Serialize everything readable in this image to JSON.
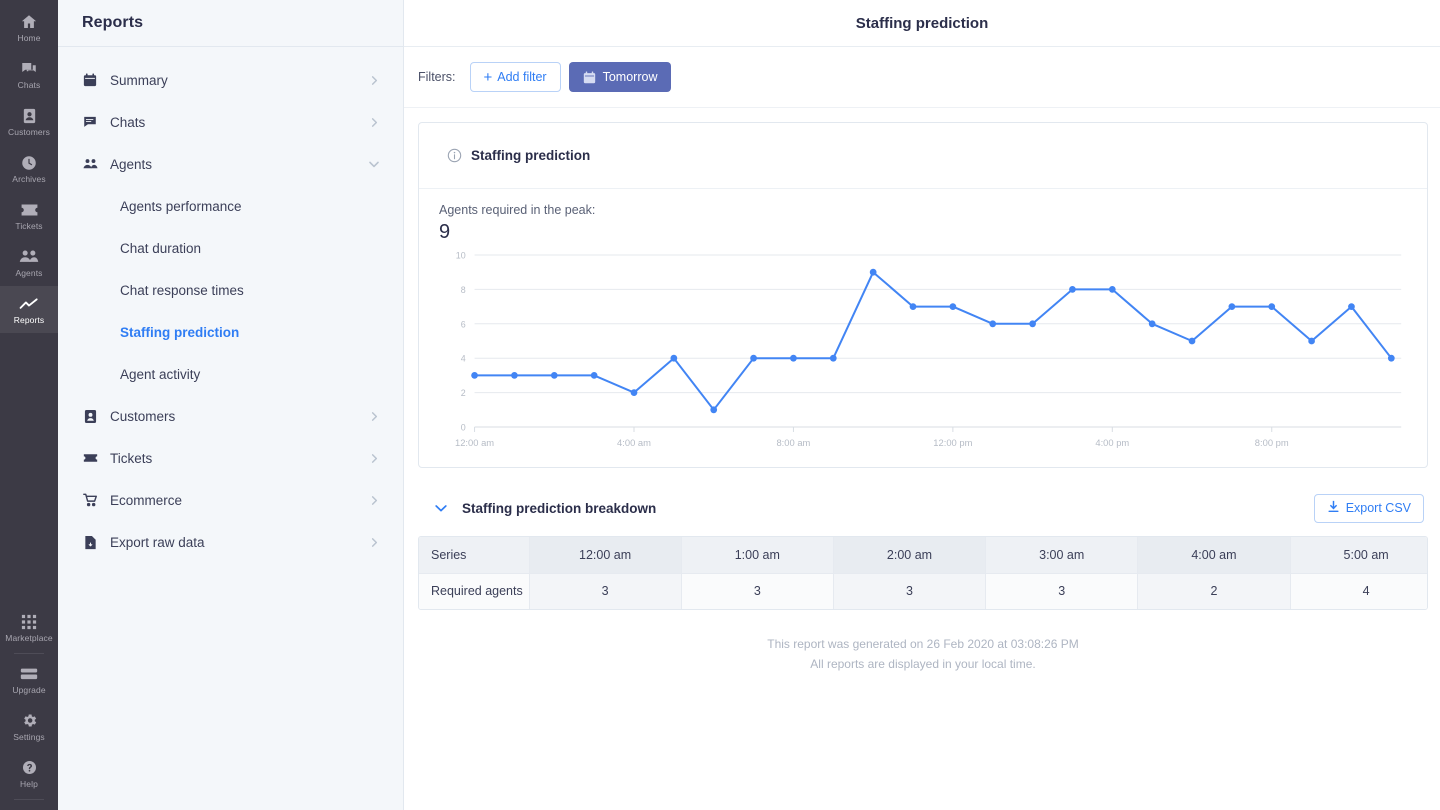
{
  "rail": {
    "top_items": [
      {
        "label": "Home",
        "icon": "home-icon",
        "active": false
      },
      {
        "label": "Chats",
        "icon": "chats-icon",
        "active": false
      },
      {
        "label": "Customers",
        "icon": "customers-icon",
        "active": false
      },
      {
        "label": "Archives",
        "icon": "archives-clock-icon",
        "active": false
      },
      {
        "label": "Tickets",
        "icon": "tickets-icon",
        "active": false
      },
      {
        "label": "Agents",
        "icon": "agents-icon",
        "active": false
      },
      {
        "label": "Reports",
        "icon": "reports-chart-icon",
        "active": true
      }
    ],
    "bottom_items": [
      {
        "label": "Marketplace",
        "icon": "marketplace-grid-icon"
      },
      {
        "label": "Upgrade",
        "icon": "upgrade-icon"
      },
      {
        "label": "Settings",
        "icon": "gear-icon"
      },
      {
        "label": "Help",
        "icon": "help-question-icon"
      }
    ]
  },
  "nav": {
    "title": "Reports",
    "items": [
      {
        "label": "Summary",
        "icon": "calendar-icon",
        "chevron": "right"
      },
      {
        "label": "Chats",
        "icon": "chat-bubble-icon",
        "chevron": "right"
      },
      {
        "label": "Agents",
        "icon": "agents-icon",
        "chevron": "down"
      }
    ],
    "sub_items": [
      {
        "label": "Agents performance",
        "selected": false
      },
      {
        "label": "Chat duration",
        "selected": false
      },
      {
        "label": "Chat response times",
        "selected": false
      },
      {
        "label": "Staffing prediction",
        "selected": true
      },
      {
        "label": "Agent activity",
        "selected": false
      }
    ],
    "items_after": [
      {
        "label": "Customers",
        "icon": "customers-card-icon",
        "chevron": "right"
      },
      {
        "label": "Tickets",
        "icon": "ticket-icon",
        "chevron": "right"
      },
      {
        "label": "Ecommerce",
        "icon": "cart-icon",
        "chevron": "right"
      },
      {
        "label": "Export raw data",
        "icon": "file-icon",
        "chevron": "right"
      }
    ]
  },
  "header": {
    "title": "Staffing prediction"
  },
  "filters": {
    "label": "Filters:",
    "add_filter_label": "Add filter",
    "date_filter_label": "Tomorrow"
  },
  "card": {
    "title": "Staffing prediction",
    "peak_label": "Agents required in the peak:",
    "peak_value": "9"
  },
  "breakdown": {
    "title": "Staffing prediction breakdown",
    "export_label": "Export CSV",
    "series_header": "Series",
    "row_label": "Required agents",
    "columns": [
      "12:00 am",
      "1:00 am",
      "2:00 am",
      "3:00 am",
      "4:00 am",
      "5:00 am"
    ],
    "values": [
      "3",
      "3",
      "3",
      "3",
      "2",
      "4"
    ]
  },
  "footnote": {
    "line1": "This report was generated on 26 Feb 2020 at 03:08:26 PM",
    "line2": "All reports are displayed in your local time."
  },
  "colors": {
    "accent_blue": "#2f7df4",
    "line_blue": "#4285f4",
    "filter_indigo": "#5b6bb5",
    "rail_bg": "#3c3a45",
    "nav_bg": "#f4f7fa"
  },
  "chart_data": {
    "type": "line",
    "title": "Staffing prediction",
    "xlabel": "",
    "ylabel": "",
    "ylim": [
      0,
      10
    ],
    "yticks": [
      0,
      2,
      4,
      6,
      8,
      10
    ],
    "xticks": [
      "12:00 am",
      "4:00 am",
      "8:00 am",
      "12:00 pm",
      "4:00 pm",
      "8:00 pm"
    ],
    "xtick_hours": [
      0,
      4,
      8,
      12,
      16,
      20
    ],
    "grid": true,
    "legend": "none",
    "x": [
      "12:00 am",
      "1:00 am",
      "2:00 am",
      "3:00 am",
      "4:00 am",
      "5:00 am",
      "6:00 am",
      "7:00 am",
      "8:00 am",
      "9:00 am",
      "10:00 am",
      "11:00 am",
      "12:00 pm",
      "1:00 pm",
      "2:00 pm",
      "3:00 pm",
      "4:00 pm",
      "5:00 pm",
      "6:00 pm",
      "7:00 pm",
      "8:00 pm",
      "9:00 pm",
      "10:00 pm",
      "11:00 pm"
    ],
    "series": [
      {
        "name": "Required agents",
        "color": "#4285f4",
        "values": [
          3,
          3,
          3,
          3,
          2,
          4,
          1,
          4,
          4,
          4,
          9,
          7,
          7,
          6,
          6,
          8,
          8,
          6,
          5,
          7,
          7,
          5,
          7,
          4
        ]
      }
    ]
  }
}
